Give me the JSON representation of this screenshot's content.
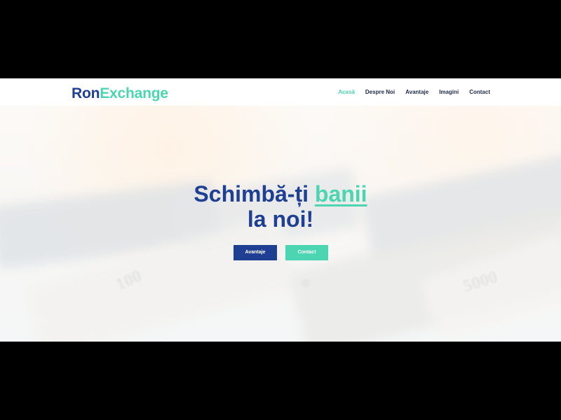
{
  "brand": {
    "name_primary": "Ron",
    "name_accent": "Exchange"
  },
  "nav": {
    "items": [
      {
        "label": "Acasă",
        "active": true
      },
      {
        "label": "Despre Noi",
        "active": false
      },
      {
        "label": "Avantaje",
        "active": false
      },
      {
        "label": "Imagini",
        "active": false
      },
      {
        "label": "Contact",
        "active": false
      }
    ]
  },
  "hero": {
    "title_line1_before": "Schimbă-ți",
    "title_line1_highlight": "banii",
    "title_line2": "la noi!",
    "primary_button": "Avantaje",
    "secondary_button": "Contact"
  },
  "colors": {
    "primary": "#1f3f93",
    "accent": "#4bd5b1",
    "nav_text": "#1e2a4a",
    "frame": "#000000"
  }
}
